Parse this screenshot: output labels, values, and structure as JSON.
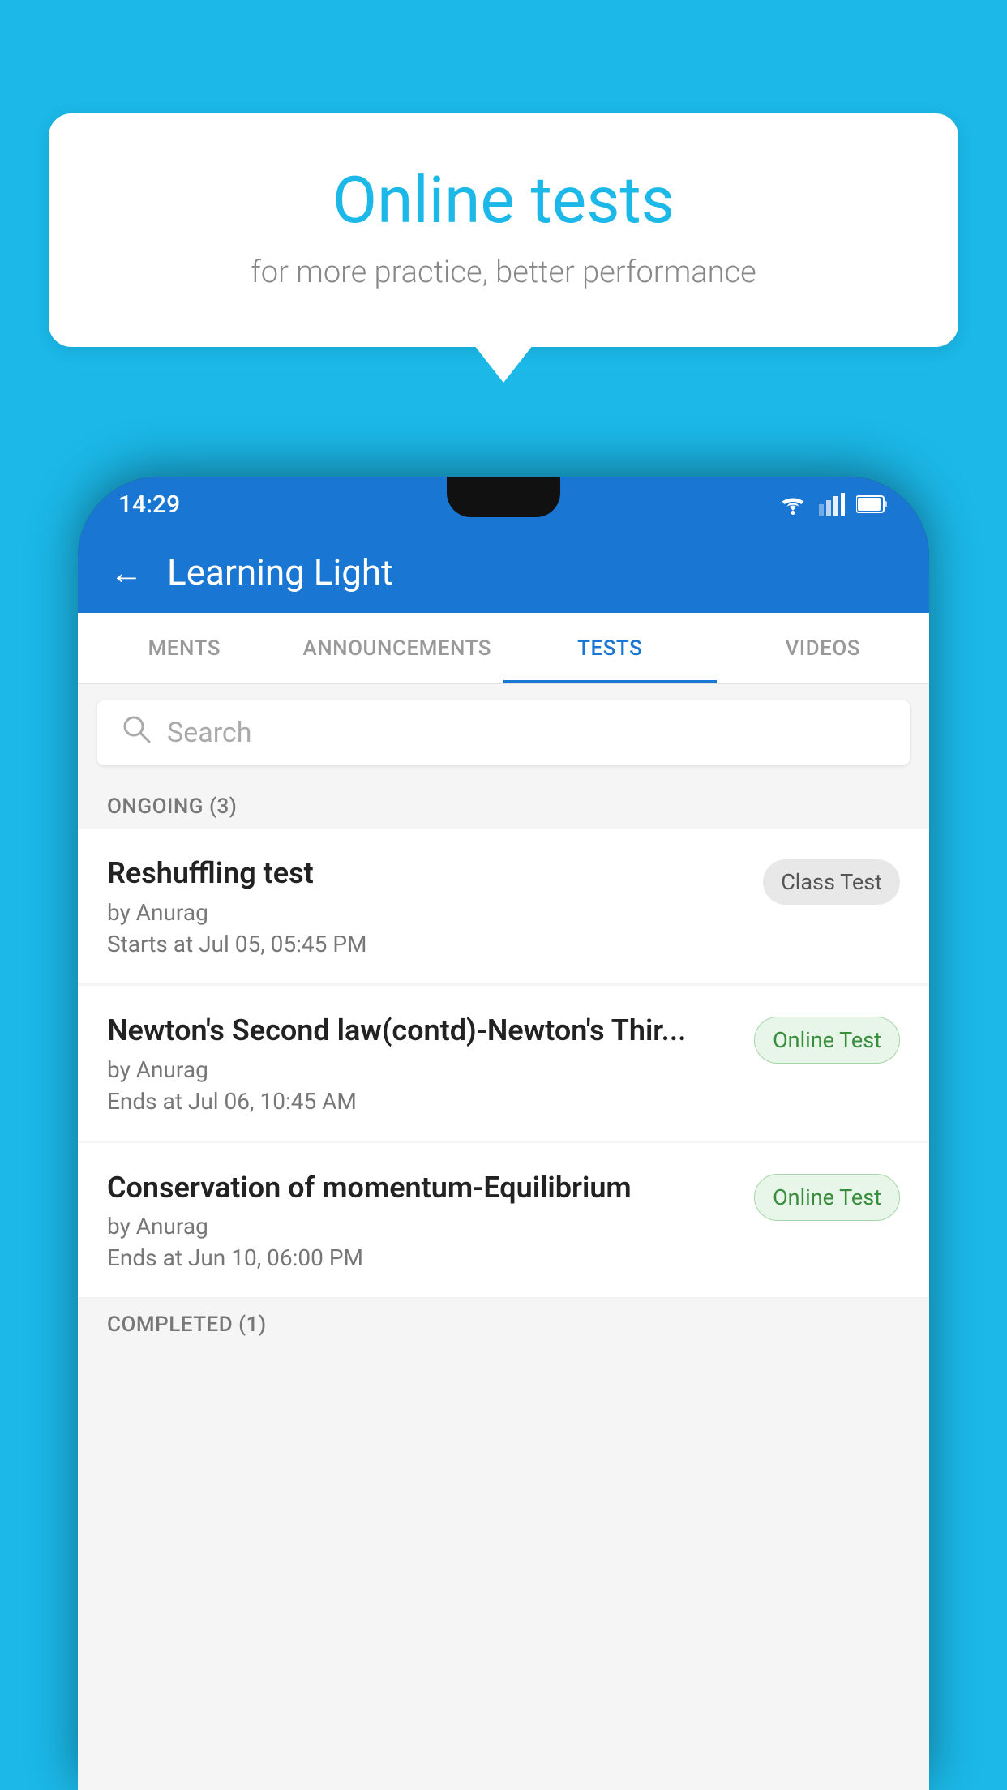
{
  "background": {
    "color": "#1BB8E8"
  },
  "speech_bubble": {
    "title": "Online tests",
    "subtitle": "for more practice, better performance"
  },
  "phone": {
    "status_bar": {
      "time": "14:29",
      "wifi_icon": "wifi",
      "signal_icon": "signal",
      "battery_icon": "battery"
    },
    "app_bar": {
      "back_label": "←",
      "title": "Learning Light"
    },
    "tabs": [
      {
        "label": "MENTS",
        "active": false
      },
      {
        "label": "ANNOUNCEMENTS",
        "active": false
      },
      {
        "label": "TESTS",
        "active": true
      },
      {
        "label": "VIDEOS",
        "active": false
      }
    ],
    "search": {
      "placeholder": "Search"
    },
    "section_ongoing": {
      "label": "ONGOING (3)"
    },
    "tests": [
      {
        "title": "Reshuffling test",
        "author": "by Anurag",
        "time_label": "Starts at",
        "time_value": "Jul 05, 05:45 PM",
        "badge": "Class Test",
        "badge_type": "class"
      },
      {
        "title": "Newton's Second law(contd)-Newton's Thir...",
        "author": "by Anurag",
        "time_label": "Ends at",
        "time_value": "Jul 06, 10:45 AM",
        "badge": "Online Test",
        "badge_type": "online"
      },
      {
        "title": "Conservation of momentum-Equilibrium",
        "author": "by Anurag",
        "time_label": "Ends at",
        "time_value": "Jun 10, 06:00 PM",
        "badge": "Online Test",
        "badge_type": "online"
      }
    ],
    "section_completed": {
      "label": "COMPLETED (1)"
    }
  }
}
